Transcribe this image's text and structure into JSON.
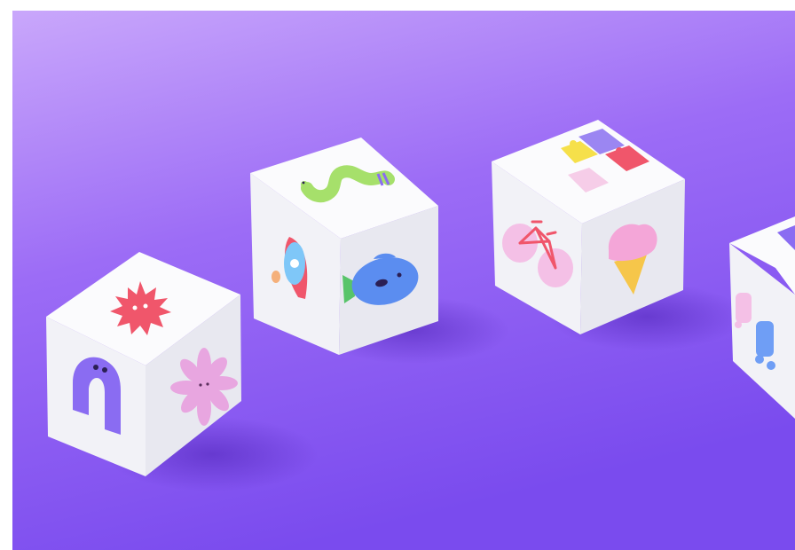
{
  "scene": {
    "background_top": "#c7a3fb",
    "background_bottom": "#7e4ff0",
    "cube_face_top": "#fbfbfd",
    "cube_face_left": "#f1f1f6",
    "cube_face_right": "#e7e7ef",
    "shadow_color": "#5b2fc6"
  },
  "cubes": [
    {
      "name": "cube-1",
      "top_icon": "red-spiky-sun-icon",
      "left_icon": "purple-arch-creature-icon",
      "right_icon": "pink-flower-face-icon"
    },
    {
      "name": "cube-2",
      "top_icon": "green-snake-letter-s-icon",
      "left_icon": "rocket-icon",
      "right_icon": "blue-fish-icon"
    },
    {
      "name": "cube-3",
      "top_icon": "puzzle-blocks-icon",
      "left_icon": "bicycle-icon",
      "right_icon": "ice-cream-cone-icon"
    },
    {
      "name": "cube-4",
      "top_icon": "partial-triangle-icon",
      "left_icon": "toy-cars-icon",
      "right_icon": ""
    }
  ]
}
